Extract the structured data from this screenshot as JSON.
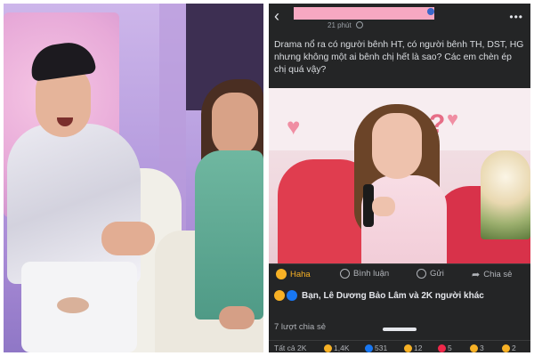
{
  "post": {
    "time": "21 phút",
    "text": "Drama nổ ra có người bênh HT, có người bênh TH, DST, HG nhưng không một ai bênh chị hết là sao? Các em chèn ép chị quá vậy?"
  },
  "actions": {
    "haha": "Haha",
    "comment": "Bình luận",
    "send": "Gửi",
    "share": "Chia sẻ"
  },
  "reactors": "Bạn, Lê Dương Bảo Lâm và 2K người khác",
  "shares": "7 lượt chia sẻ",
  "reaction_tabs": [
    {
      "label": "Tất cả 2K",
      "icon": ""
    },
    {
      "label": "1,4K",
      "icon": "haha-icon"
    },
    {
      "label": "531",
      "icon": "like-icon"
    },
    {
      "label": "12",
      "icon": "wow-icon"
    },
    {
      "label": "5",
      "icon": "heart-icon"
    },
    {
      "label": "3",
      "icon": "sad-icon"
    },
    {
      "label": "2",
      "icon": "care-icon"
    }
  ],
  "colors": {
    "fb_bg": "#242526",
    "accent_haha": "#f7b125",
    "accent_like": "#1877f2",
    "name_redaction": "#f7a8c2"
  }
}
